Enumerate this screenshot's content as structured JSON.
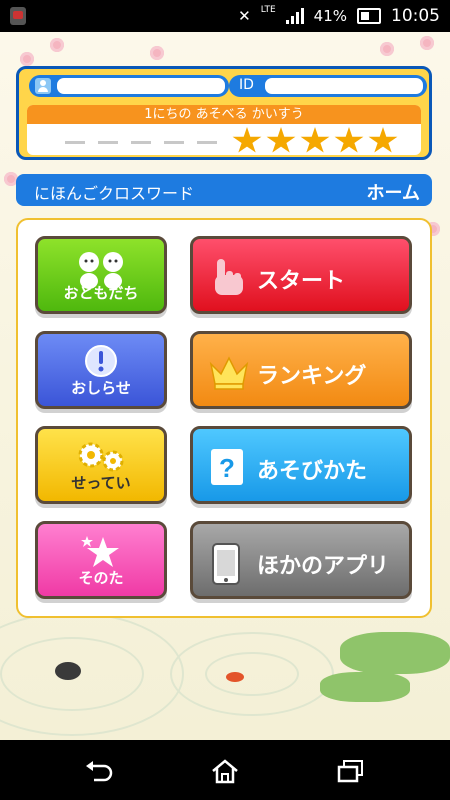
{
  "status_bar": {
    "network": "LTE",
    "battery": "41%",
    "time": "10:05"
  },
  "profile": {
    "id_label": "ID",
    "play_count_label": "1にちの あそべる かいすう",
    "play_count_stars": 5
  },
  "header": {
    "app_title": "にほんごクロスワード",
    "screen_title": "ホーム"
  },
  "menu": {
    "friends": "おともだち",
    "start": "スタート",
    "notice": "おしらせ",
    "ranking": "ランキング",
    "settings": "せってい",
    "howto": "あそびかた",
    "other": "そのた",
    "other_apps": "ほかのアプリ"
  },
  "nav": {
    "back_icon": "back-icon",
    "home_icon": "home-icon",
    "recents_icon": "recents-icon"
  },
  "colors": {
    "accent_blue": "#1e7be0",
    "card_yellow": "#ffd54a",
    "play_orange": "#f7931e",
    "star_gold": "#f5a800"
  }
}
